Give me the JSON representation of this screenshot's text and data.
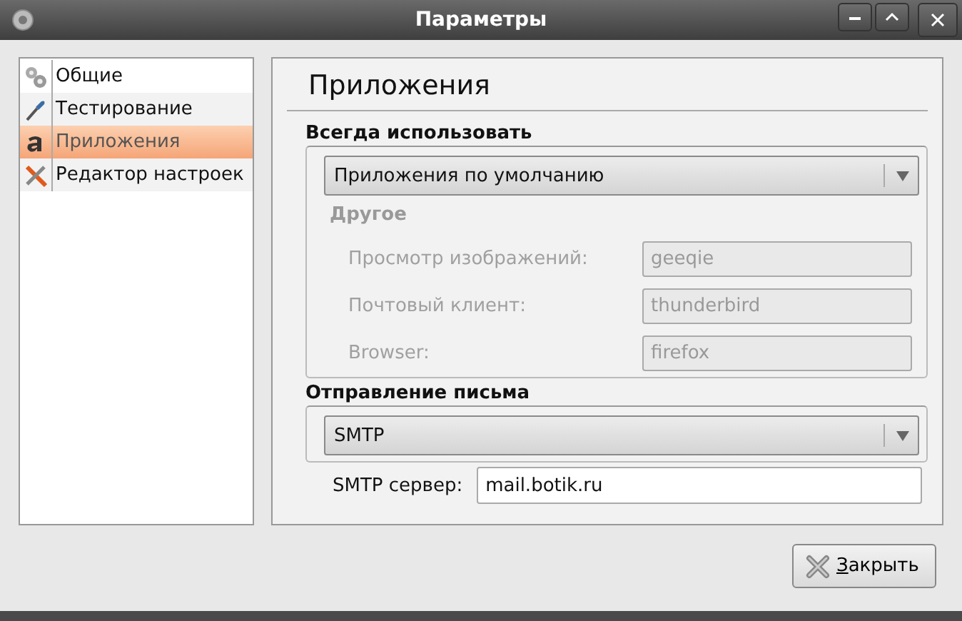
{
  "window": {
    "title": "Параметры"
  },
  "sidebar": {
    "items": [
      {
        "label": "Общие",
        "selected": false
      },
      {
        "label": "Тестирование",
        "selected": false
      },
      {
        "label": "Приложения",
        "selected": true
      },
      {
        "label": "Редактор настроек",
        "selected": false
      }
    ]
  },
  "panel": {
    "title": "Приложения",
    "sections": [
      {
        "title": "Всегда использовать",
        "combo": {
          "value": "Приложения по умолчанию"
        },
        "subgroup": {
          "title": "Другое",
          "disabled": true,
          "rows": [
            {
              "label": "Просмотр изображений:",
              "value": "geeqie"
            },
            {
              "label": "Почтовый клиент:",
              "value": "thunderbird"
            },
            {
              "label": "Browser:",
              "value": "firefox"
            }
          ]
        }
      },
      {
        "title": "Отправление письма",
        "combo": {
          "value": "SMTP"
        },
        "rows": [
          {
            "label": "SMTP сервер:",
            "value": "mail.botik.ru"
          }
        ]
      }
    ]
  },
  "buttons": [
    {
      "label": "Закрыть",
      "mnemonic": true
    }
  ]
}
